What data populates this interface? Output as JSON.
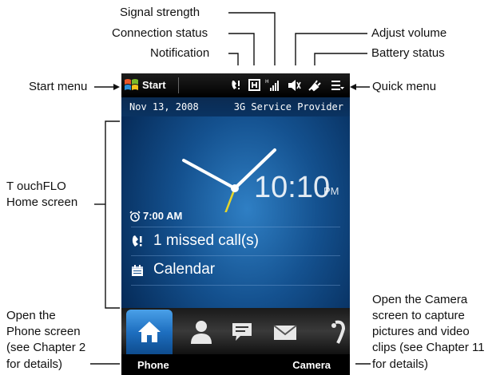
{
  "labels": {
    "signal_strength": "Signal strength",
    "connection_status": "Connection status",
    "notification": "Notification",
    "adjust_volume": "Adjust volume",
    "battery_status": "Battery status",
    "start_menu": "Start menu",
    "quick_menu": "Quick menu",
    "touchflo_line1": "T ouchFLO",
    "touchflo_line2": "Home screen",
    "phone_note": [
      "Open the",
      "Phone screen",
      "(see Chapter 2",
      "for details)"
    ],
    "camera_note": [
      "Open the Camera",
      "screen to capture",
      "pictures and video",
      "clips (see Chapter 11",
      "for details)"
    ]
  },
  "phone": {
    "start_label": "Start",
    "date": "Nov 13, 2008",
    "provider": "3G Service Provider",
    "time": "10:10",
    "ampm": "PM",
    "alarm": "7:00 AM",
    "missed_calls": "1 missed call(s)",
    "calendar": "Calendar",
    "left_softkey": "Phone",
    "right_softkey": "Camera",
    "colors": {
      "status_bar": "#000000",
      "screen": "#14518f",
      "tab_active": "#1e6fc0"
    }
  }
}
